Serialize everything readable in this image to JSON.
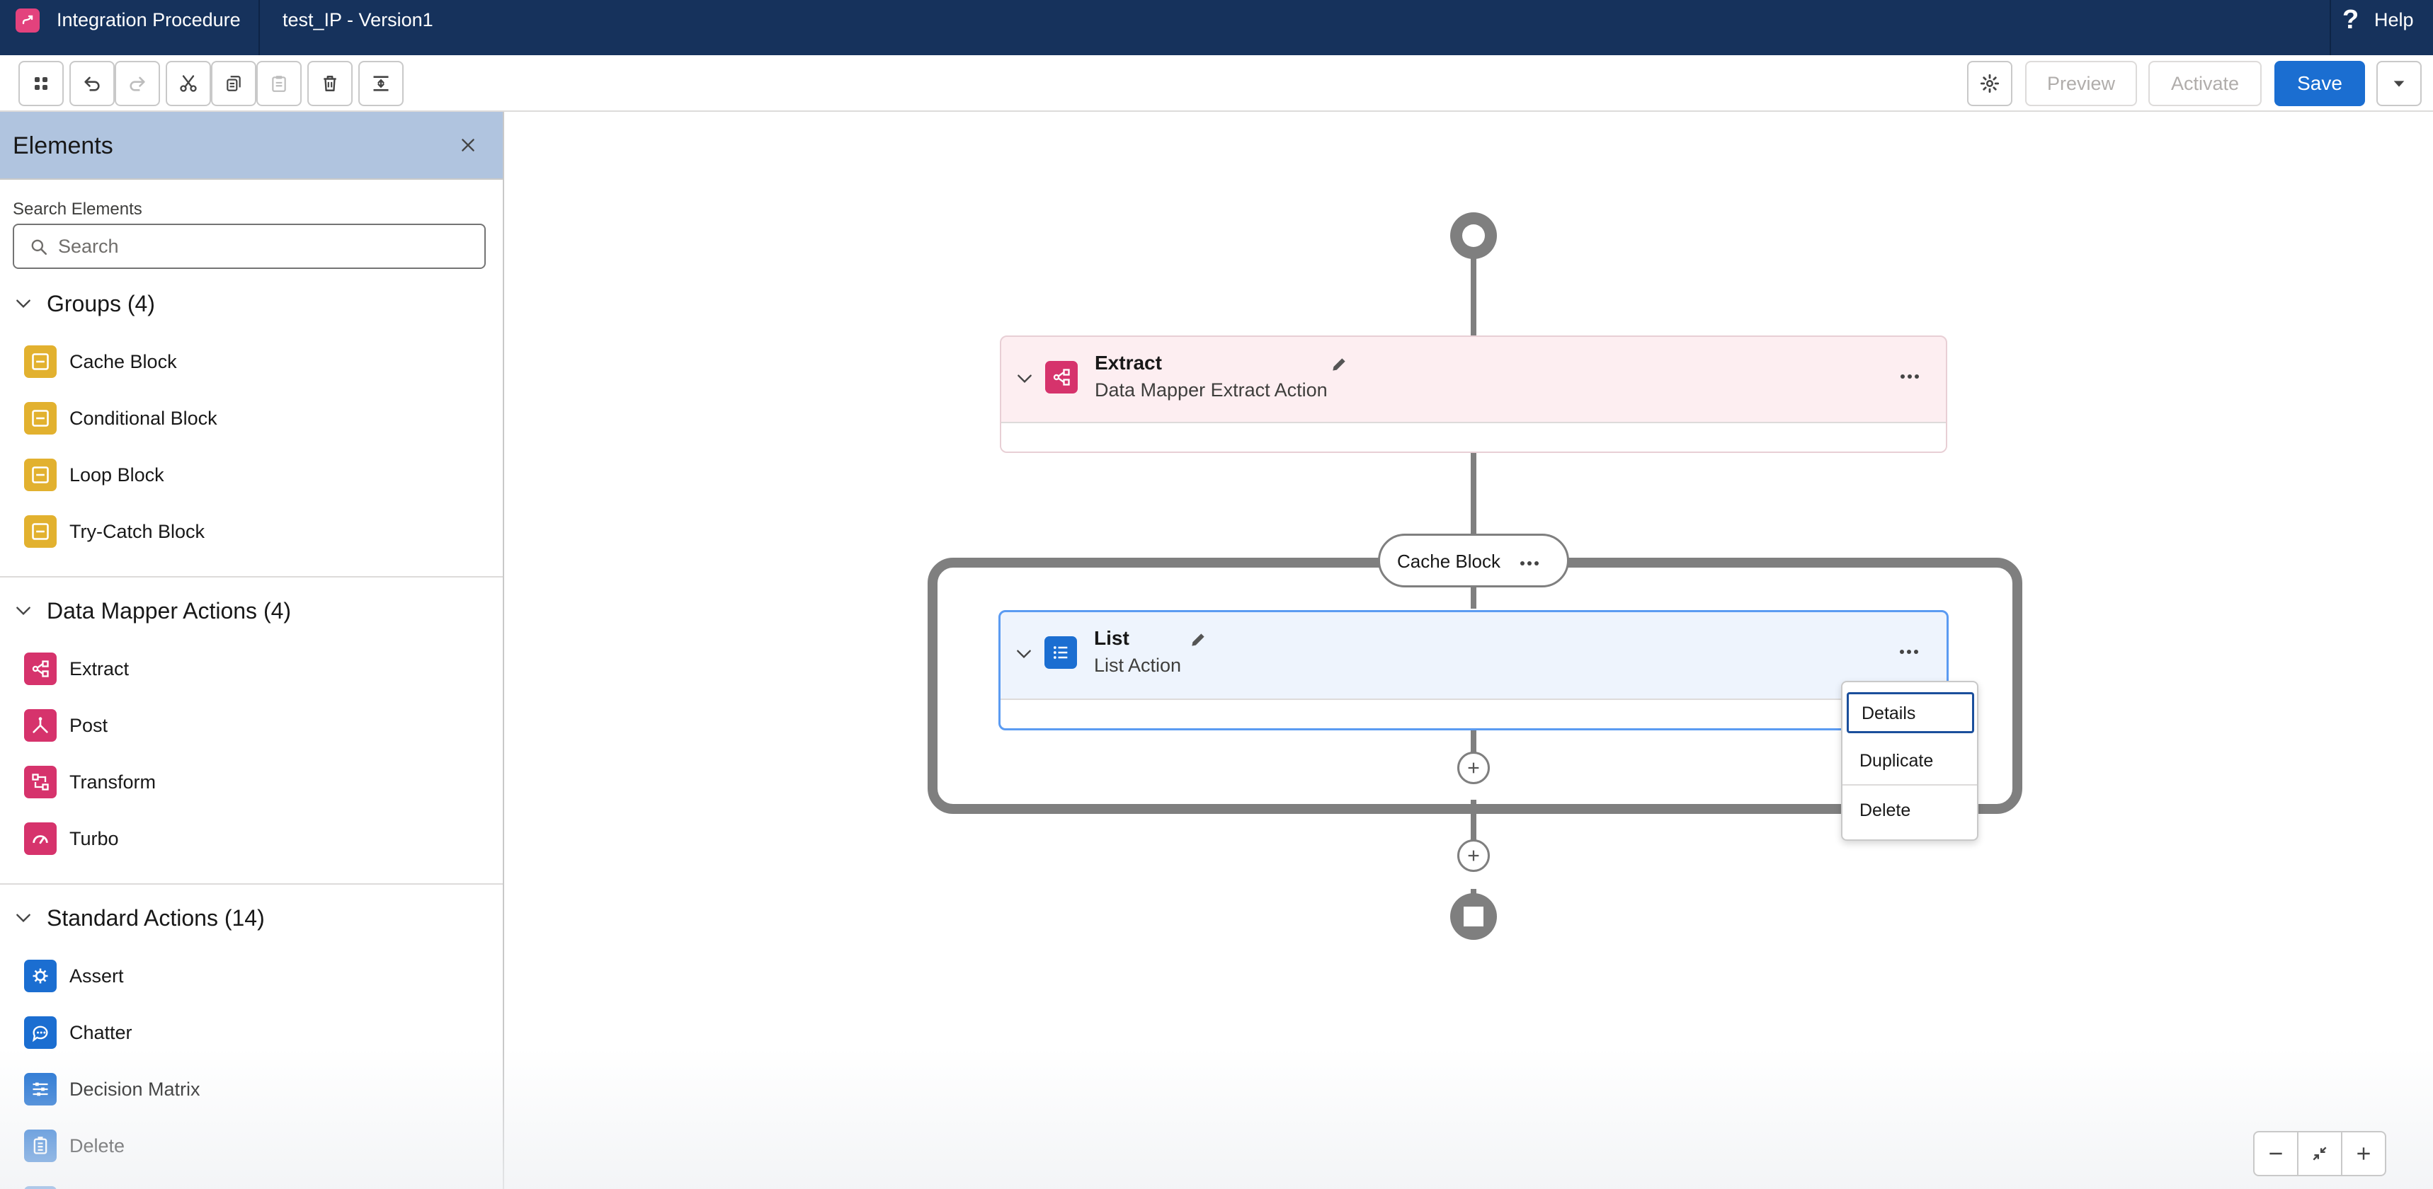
{
  "header": {
    "app_title": "Integration Procedure",
    "version_title": "test_IP - Version1",
    "help_label": "Help",
    "help_icon": "?"
  },
  "toolbar": {
    "preview_label": "Preview",
    "activate_label": "Activate",
    "save_label": "Save"
  },
  "sidebar": {
    "title": "Elements",
    "search_label": "Search Elements",
    "search_placeholder": "Search",
    "search_value": "",
    "sections": [
      {
        "label": "Groups (4)",
        "items": [
          "Cache Block",
          "Conditional Block",
          "Loop Block",
          "Try-Catch Block"
        ]
      },
      {
        "label": "Data Mapper Actions (4)",
        "items": [
          "Extract",
          "Post",
          "Transform",
          "Turbo"
        ]
      },
      {
        "label": "Standard Actions (14)",
        "items": [
          "Assert",
          "Chatter",
          "Decision Matrix",
          "Delete"
        ]
      }
    ]
  },
  "canvas": {
    "extract_card": {
      "title": "Extract",
      "subtitle": "Data Mapper Extract Action"
    },
    "cache_block": {
      "label": "Cache Block"
    },
    "list_card": {
      "title": "List",
      "subtitle": "List Action"
    },
    "context_menu": {
      "items": [
        "Details",
        "Duplicate",
        "Delete"
      ]
    }
  },
  "colors": {
    "header_bg": "#16325c",
    "accent": "#1b6ed1",
    "group_icon": "#e2b12f",
    "data_mapper_icon": "#d6336c",
    "standard_icon": "#1b6ed1",
    "extract_card_bg": "#fdeef1",
    "list_card_bg": "#eef4fd",
    "connector": "#7f7f7f"
  }
}
